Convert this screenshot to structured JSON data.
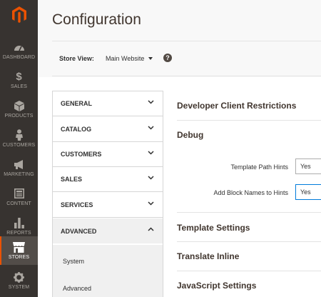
{
  "sidebar": {
    "items": [
      {
        "label": "DASHBOARD",
        "icon": "dashboard-icon"
      },
      {
        "label": "SALES",
        "icon": "dollar-icon"
      },
      {
        "label": "PRODUCTS",
        "icon": "cube-icon"
      },
      {
        "label": "CUSTOMERS",
        "icon": "person-icon"
      },
      {
        "label": "MARKETING",
        "icon": "megaphone-icon"
      },
      {
        "label": "CONTENT",
        "icon": "layout-icon"
      },
      {
        "label": "REPORTS",
        "icon": "bar-chart-icon"
      },
      {
        "label": "STORES",
        "icon": "store-icon"
      },
      {
        "label": "SYSTEM",
        "icon": "gear-icon"
      }
    ],
    "active": "STORES"
  },
  "page": {
    "title": "Configuration"
  },
  "store_switcher": {
    "label": "Store View:",
    "value": "Main Website"
  },
  "tabs": {
    "items": [
      "GENERAL",
      "CATALOG",
      "CUSTOMERS",
      "SALES",
      "SERVICES",
      "ADVANCED"
    ],
    "open": "ADVANCED",
    "subitems": [
      "System",
      "Advanced"
    ]
  },
  "sections": {
    "dev_client": "Developer Client Restrictions",
    "debug": "Debug",
    "template_settings": "Template Settings",
    "translate_inline": "Translate Inline",
    "js_settings": "JavaScript Settings"
  },
  "debug_fields": {
    "template_hints_label": "Template Path Hints",
    "template_hints_value": "Yes",
    "block_names_label": "Add Block Names to Hints",
    "block_names_value": "Yes"
  },
  "colors": {
    "sidebar": "#373330",
    "accent": "#eb5202",
    "active_item": "#524d49"
  }
}
